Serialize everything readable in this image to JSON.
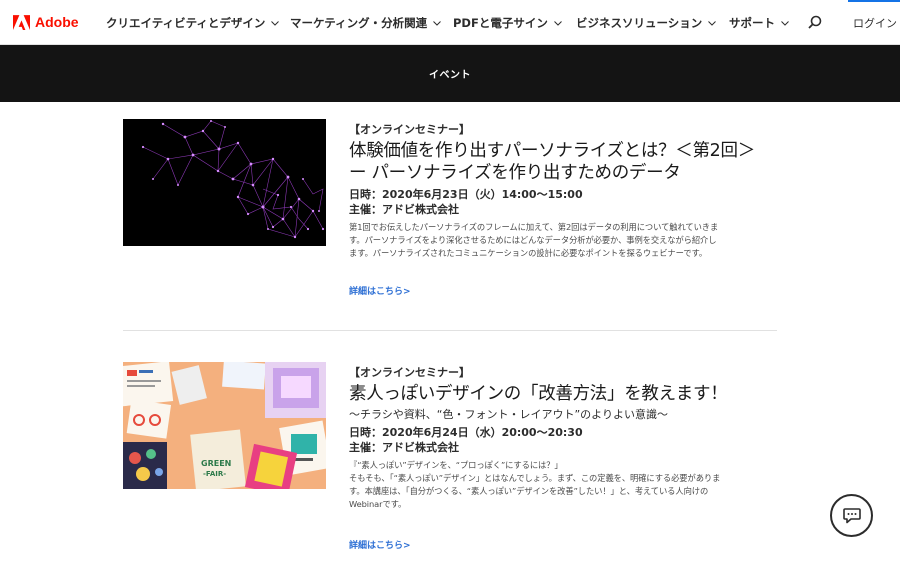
{
  "brand": {
    "name": "Adobe",
    "color": "#fa0f00"
  },
  "nav": {
    "items": [
      {
        "label": "クリエイティビティとデザイン"
      },
      {
        "label": "マーケティング・分析関連"
      },
      {
        "label": "PDFと電子サイン"
      },
      {
        "label": "ビジネスソリューション"
      },
      {
        "label": "サポート"
      }
    ],
    "search_icon": "search-icon",
    "login_label": "ログイン"
  },
  "banner": {
    "title": "イベント"
  },
  "events": [
    {
      "tag": "【オンラインセミナー】",
      "title_line1": "体験価値を作り出すパーソナライズとは？＜第2回＞",
      "title_line2": "ー パーソナライズを作り出すためのデータ",
      "date": "日時：2020年6月23日（火）14:00〜15:00",
      "host": "主催：アドビ株式会社",
      "desc_lines": [
        "第1回でお伝えしたパーソナライズのフレームに加えて、第2回はデータの利用について触れていきま",
        "す。パーソナライズをより深化させるためにはどんなデータ分析が必要か、事例を交えながら紹介し",
        "ます。パーソナライズされたコミュニケーションの設計に必要なポイントを探るウェビナーです。"
      ],
      "more_label": "詳細はこちら>"
    },
    {
      "tag": "【オンラインセミナー】",
      "title_line1": "素人っぽいデザインの「改善方法」を教えます！",
      "subtitle": "〜チラシや資料、“色・フォント・レイアウト”のよりよい意識〜",
      "date": "日時：2020年6月24日（水）20:00〜20:30",
      "host": "主催：アドビ株式会社",
      "desc_lines": [
        "『“素人っぽい”デザインを、“プロっぽく”にするには？」",
        "そもそも、「“素人っぽい”デザイン」とはなんでしょう。まず、この定義を、明確にする必要がありま",
        "す。本講座は、「自分がつくる、“素人っぽい”デザインを改善”したい！」と、考えている人向けの",
        "Webinarです。"
      ],
      "more_label": "詳細はこちら>"
    }
  ],
  "chat": {
    "icon": "chat-icon"
  }
}
